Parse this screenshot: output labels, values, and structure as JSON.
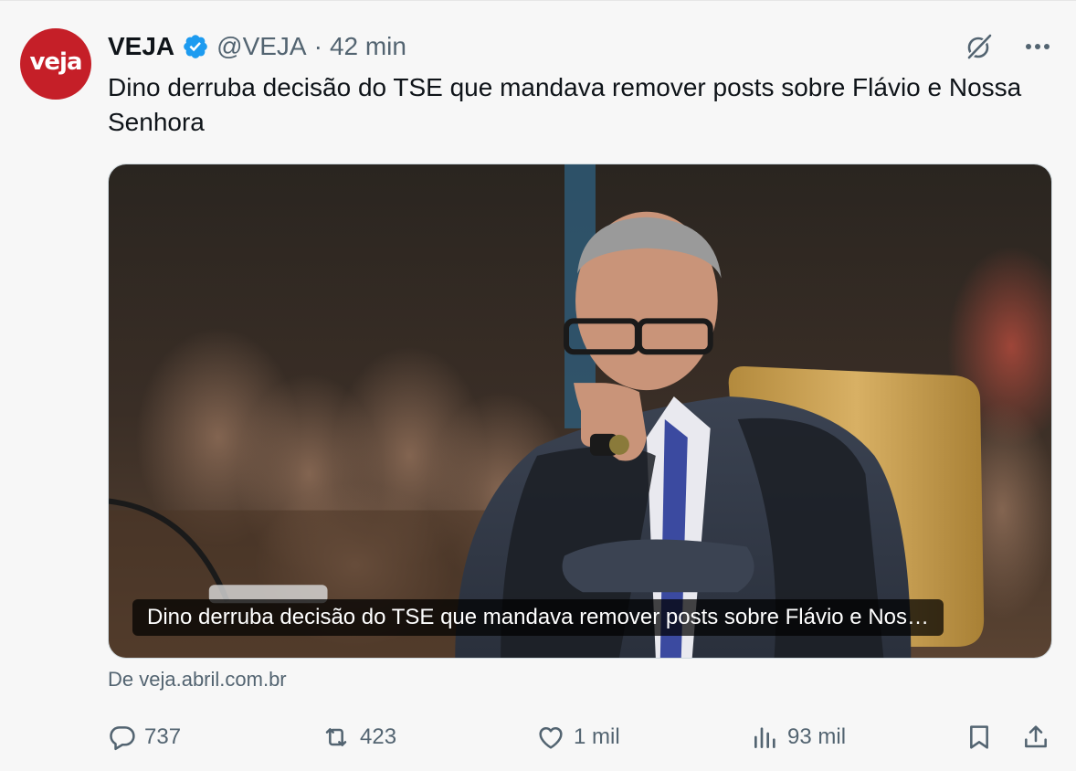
{
  "author": {
    "avatar_text": "veja",
    "display_name": "VEJA",
    "handle": "@VEJA",
    "separator": "·",
    "time": "42 min",
    "verified_icon": "verified-badge-icon",
    "avatar_color": "#c51f28"
  },
  "header_actions": {
    "grok_icon": "grok-icon",
    "more_icon": "more-icon"
  },
  "tweet": {
    "text": "Dino derruba decisão do TSE que mandava remover posts sobre Flávio e Nossa Senhora"
  },
  "media": {
    "caption": "Dino derruba decisão do TSE que mandava remover posts sobre Flávio e Nos…"
  },
  "source": "De veja.abril.com.br",
  "actions": {
    "reply_count": "737",
    "retweet_count": "423",
    "like_count": "1 mil",
    "views_count": "93 mil",
    "reply_icon": "reply-icon",
    "retweet_icon": "retweet-icon",
    "like_icon": "heart-icon",
    "views_icon": "views-icon",
    "bookmark_icon": "bookmark-icon",
    "share_icon": "share-icon"
  },
  "colors": {
    "accent": "#1d9bf0",
    "muted_text": "#536471"
  }
}
